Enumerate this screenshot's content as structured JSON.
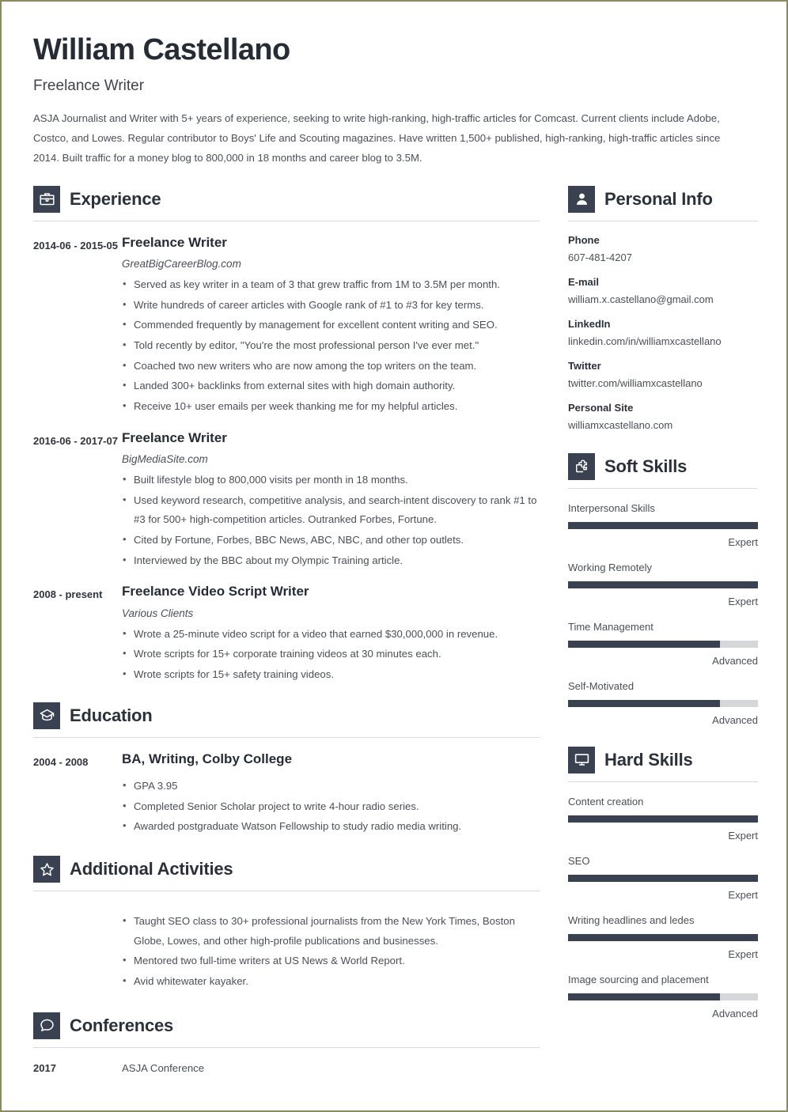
{
  "header": {
    "name": "William Castellano",
    "title": "Freelance Writer",
    "summary": "ASJA Journalist and Writer with 5+ years of experience, seeking to write high-ranking, high-traffic articles for Comcast. Current clients include Adobe, Costco, and Lowes. Regular contributor to Boys' Life and Scouting magazines. Have written 1,500+ published, high-ranking, high-traffic articles since 2014. Built traffic for a money blog to 800,000 in 18 months and career blog to 3.5M."
  },
  "sections": {
    "experience": {
      "title": "Experience",
      "icon": "briefcase-icon",
      "entries": [
        {
          "dates": "2014-06 - 2015-05",
          "role": "Freelance Writer",
          "org": "GreatBigCareerBlog.com",
          "bullets": [
            "Served as key writer in a team of 3 that grew traffic from 1M to 3.5M per month.",
            "Write hundreds of career articles with Google rank of #1 to #3 for key terms.",
            "Commended frequently by management for excellent content writing and SEO.",
            "Told recently by editor, \"You're the most professional person I've ever met.\"",
            "Coached two new writers who are now among the top writers on the team.",
            "Landed 300+ backlinks from external sites with high domain authority.",
            "Receive 10+ user emails per week thanking me for my helpful articles."
          ]
        },
        {
          "dates": "2016-06 - 2017-07",
          "role": "Freelance Writer",
          "org": "BigMediaSite.com",
          "bullets": [
            "Built lifestyle blog to 800,000 visits per month in 18 months.",
            "Used keyword research, competitive analysis, and search-intent discovery to rank #1 to #3 for 500+ high-competition articles. Outranked Forbes, Fortune.",
            "Cited by Fortune, Forbes, BBC News, ABC, NBC, and other top outlets.",
            "Interviewed by the BBC about my Olympic Training article."
          ]
        },
        {
          "dates": "2008 - present",
          "role": "Freelance Video Script Writer",
          "org": "Various Clients",
          "bullets": [
            "Wrote a 25-minute video script for a video that earned $30,000,000 in revenue.",
            "Wrote scripts for 15+ corporate training videos at 30 minutes each.",
            "Wrote scripts for 15+ safety training videos."
          ]
        }
      ]
    },
    "education": {
      "title": "Education",
      "icon": "graduation-cap-icon",
      "entries": [
        {
          "dates": "2004 - 2008",
          "role": "BA, Writing, Colby College",
          "bullets": [
            "GPA 3.95",
            "Completed Senior Scholar project to write 4-hour radio series.",
            "Awarded postgraduate Watson Fellowship to study radio media writing."
          ]
        }
      ]
    },
    "additional_activities": {
      "title": "Additional Activities",
      "icon": "star-icon",
      "bullets": [
        "Taught SEO class to 30+ professional journalists from the New York Times, Boston Globe, Lowes, and other high-profile publications and businesses.",
        "Mentored two full-time writers at US News & World Report.",
        "Avid whitewater kayaker."
      ]
    },
    "conferences": {
      "title": "Conferences",
      "icon": "speech-bubble-icon",
      "rows": [
        {
          "year": "2017",
          "name": "ASJA Conference"
        }
      ]
    },
    "personal_info": {
      "title": "Personal Info",
      "icon": "person-icon",
      "items": [
        {
          "label": "Phone",
          "value": "607-481-4207"
        },
        {
          "label": "E-mail",
          "value": "william.x.castellano@gmail.com"
        },
        {
          "label": "LinkedIn",
          "value": "linkedin.com/in/williamxcastellano"
        },
        {
          "label": "Twitter",
          "value": "twitter.com/williamxcastellano"
        },
        {
          "label": "Personal Site",
          "value": "williamxcastellano.com"
        }
      ]
    },
    "soft_skills": {
      "title": "Soft Skills",
      "icon": "puzzle-piece-icon",
      "items": [
        {
          "name": "Interpersonal Skills",
          "level": "Expert",
          "percent": 100
        },
        {
          "name": "Working Remotely",
          "level": "Expert",
          "percent": 100
        },
        {
          "name": "Time Management",
          "level": "Advanced",
          "percent": 80
        },
        {
          "name": "Self-Motivated",
          "level": "Advanced",
          "percent": 80
        }
      ]
    },
    "hard_skills": {
      "title": "Hard Skills",
      "icon": "monitor-icon",
      "items": [
        {
          "name": "Content creation",
          "level": "Expert",
          "percent": 100
        },
        {
          "name": "SEO",
          "level": "Expert",
          "percent": 100
        },
        {
          "name": "Writing headlines and ledes",
          "level": "Expert",
          "percent": 100
        },
        {
          "name": "Image sourcing and placement",
          "level": "Advanced",
          "percent": 80
        }
      ]
    }
  },
  "colors": {
    "accent_dark": "#3a4150",
    "text_dark": "#262c36",
    "text_body": "#4a4f57",
    "rule": "#d7d9dd",
    "bar_track": "#d6d7d9",
    "page_border": "#8a8c60"
  }
}
